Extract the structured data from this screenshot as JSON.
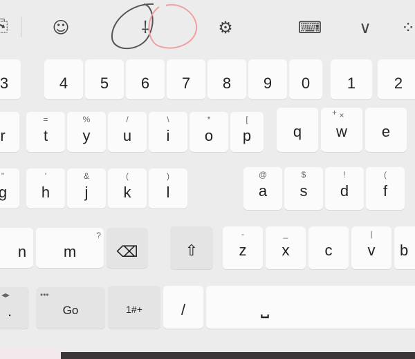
{
  "toolbar": {
    "icons": [
      {
        "name": "clipboard-icon",
        "glyph": "⎘"
      },
      {
        "name": "emoji-icon",
        "glyph": "☺"
      },
      {
        "name": "microphone-icon",
        "glyph": "⸸"
      },
      {
        "name": "settings-gear-icon",
        "glyph": "⚙"
      },
      {
        "name": "keyboard-layout-icon",
        "glyph": "⌨"
      },
      {
        "name": "collapse-chevron-icon",
        "glyph": "∨"
      },
      {
        "name": "voice-typing-icon",
        "glyph": "⁘"
      }
    ]
  },
  "rows": {
    "numbers_left": [
      "3",
      "4",
      "5",
      "6",
      "7",
      "8",
      "9",
      "0"
    ],
    "numbers_right": [
      "1",
      "2"
    ],
    "top_left": [
      {
        "main": "r",
        "sub": ""
      },
      {
        "main": "t",
        "sub": "="
      },
      {
        "main": "y",
        "sub": "%"
      },
      {
        "main": "u",
        "sub": "/"
      },
      {
        "main": "i",
        "sub": "\\"
      },
      {
        "main": "o",
        "sub": "*"
      },
      {
        "main": "p",
        "sub": "["
      }
    ],
    "top_right": [
      {
        "main": "q",
        "sub": "+"
      },
      {
        "main": "w",
        "sub": "×"
      },
      {
        "main": "e",
        "sub": ""
      }
    ],
    "home_left": [
      {
        "main": "g",
        "sub": "\""
      },
      {
        "main": "h",
        "sub": "'"
      },
      {
        "main": "j",
        "sub": "&"
      },
      {
        "main": "k",
        "sub": "("
      },
      {
        "main": "l",
        "sub": ")"
      }
    ],
    "home_right": [
      {
        "main": "a",
        "sub": "@"
      },
      {
        "main": "s",
        "sub": "$"
      },
      {
        "main": "d",
        "sub": "!"
      },
      {
        "main": "f",
        "sub": "("
      }
    ],
    "bottom_left": [
      {
        "main": "n",
        "sub": ""
      },
      {
        "main": "m",
        "sub": "?"
      }
    ],
    "bottom_right": [
      {
        "main": "z",
        "sub": "-"
      },
      {
        "main": "x",
        "sub": "_"
      },
      {
        "main": "c",
        "sub": ""
      },
      {
        "main": "v",
        "sub": "|"
      },
      {
        "main": "b",
        "sub": ""
      }
    ],
    "func": {
      "period": ".",
      "arrows": "◂▸",
      "go": "Go",
      "go_sub": "•••",
      "symbols": "1#+",
      "slash": "/",
      "space": "⎵"
    },
    "backspace": "⌫",
    "shift": "⇧"
  }
}
